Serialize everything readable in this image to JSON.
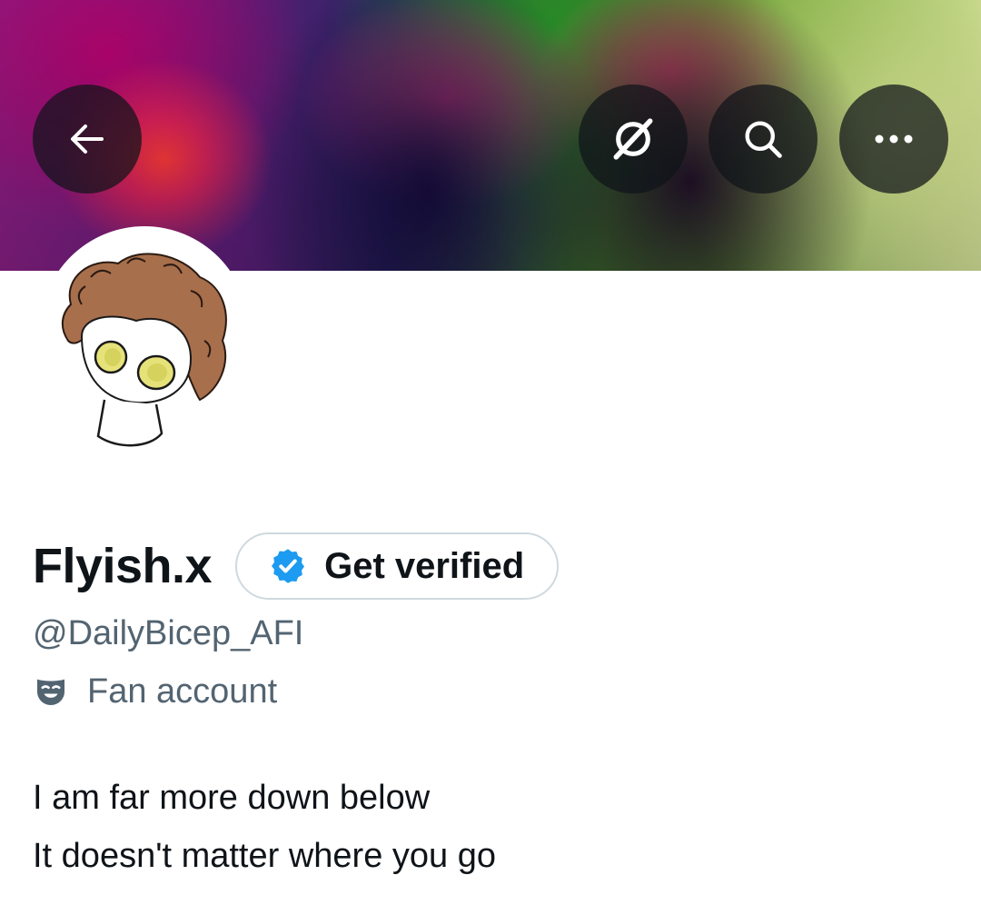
{
  "header": {
    "back_icon": "arrow-left-icon",
    "grok_icon": "grok-icon",
    "search_icon": "search-icon",
    "more_icon": "more-horizontal-icon",
    "overlay_color": "#0f1419"
  },
  "profile": {
    "display_name": "Flyish.x",
    "get_verified_label": "Get verified",
    "verified_badge_icon": "verified-badge-icon",
    "handle": "@DailyBicep_AFI",
    "category_icon": "fan-mask-icon",
    "category_label": "Fan account",
    "bio_lines": [
      "I am far more down below",
      "It doesn't matter where you go"
    ]
  },
  "colors": {
    "text_primary": "#0f1419",
    "text_secondary": "#536471",
    "verified_blue": "#1d9bf0",
    "pill_border": "#cfd9de"
  }
}
